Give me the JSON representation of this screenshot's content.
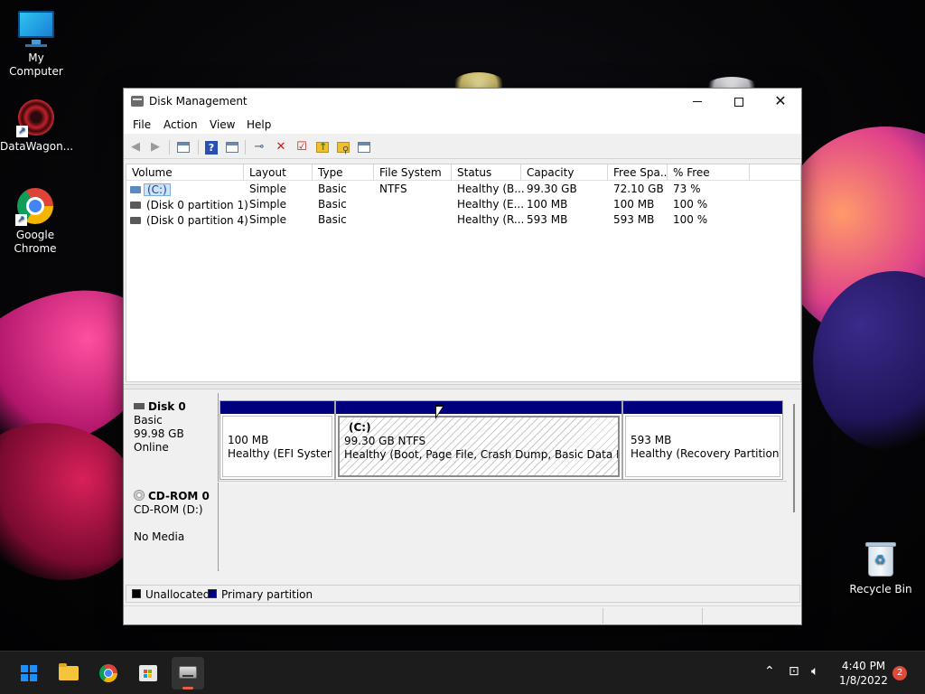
{
  "desktop": {
    "icons": [
      {
        "label": "My Computer",
        "icon": "computer-icon"
      },
      {
        "label": "DataWagon...",
        "icon": "datawagon-icon"
      },
      {
        "label": "Google Chrome",
        "icon": "chrome-icon"
      },
      {
        "label": "Recycle Bin",
        "icon": "recycle-bin-icon"
      }
    ]
  },
  "window": {
    "title": "Disk Management",
    "menu": [
      "File",
      "Action",
      "View",
      "Help"
    ],
    "toolbar_icons": [
      "back-icon",
      "forward-icon",
      "properties-icon",
      "help-icon",
      "refresh-icon",
      "connect-icon",
      "delete-icon",
      "check-icon",
      "folder-up-icon",
      "folder-search-icon",
      "list-view-icon"
    ]
  },
  "volumes": {
    "columns": [
      "Volume",
      "Layout",
      "Type",
      "File System",
      "Status",
      "Capacity",
      "Free Spa...",
      "% Free"
    ],
    "rows": [
      {
        "volume": "(C:)",
        "layout": "Simple",
        "type": "Basic",
        "fs": "NTFS",
        "status": "Healthy (B...",
        "capacity": "99.30 GB",
        "free": "72.10 GB",
        "pct": "73 %",
        "selected": true
      },
      {
        "volume": "(Disk 0 partition 1)",
        "layout": "Simple",
        "type": "Basic",
        "fs": "",
        "status": "Healthy (E...",
        "capacity": "100 MB",
        "free": "100 MB",
        "pct": "100 %",
        "selected": false
      },
      {
        "volume": "(Disk 0 partition 4)",
        "layout": "Simple",
        "type": "Basic",
        "fs": "",
        "status": "Healthy (R...",
        "capacity": "593 MB",
        "free": "593 MB",
        "pct": "100 %",
        "selected": false
      }
    ]
  },
  "disks": {
    "disk0": {
      "name": "Disk 0",
      "type": "Basic",
      "size": "99.98 GB",
      "state": "Online",
      "partitions": [
        {
          "title": "",
          "line1": "100 MB",
          "line2": "Healthy (EFI System P"
        },
        {
          "title": "(C:)",
          "line1": "99.30 GB NTFS",
          "line2": "Healthy (Boot, Page File, Crash Dump, Basic Data Partitior"
        },
        {
          "title": "",
          "line1": "593 MB",
          "line2": "Healthy (Recovery Partition)"
        }
      ]
    },
    "cdrom0": {
      "name": "CD-ROM 0",
      "drive": "CD-ROM (D:)",
      "media": "No Media"
    }
  },
  "legend": [
    {
      "label": "Unallocated",
      "color": "#000000"
    },
    {
      "label": "Primary partition",
      "color": "#00007f"
    }
  ],
  "taskbar": {
    "apps": [
      "start-icon",
      "file-explorer-icon",
      "chrome-icon",
      "store-icon",
      "disk-management-icon"
    ],
    "time": "4:40 PM",
    "date": "1/8/2022",
    "notifications": "2"
  },
  "colors": {
    "primary_partition": "#00007f",
    "selection": "#cce4f7"
  }
}
